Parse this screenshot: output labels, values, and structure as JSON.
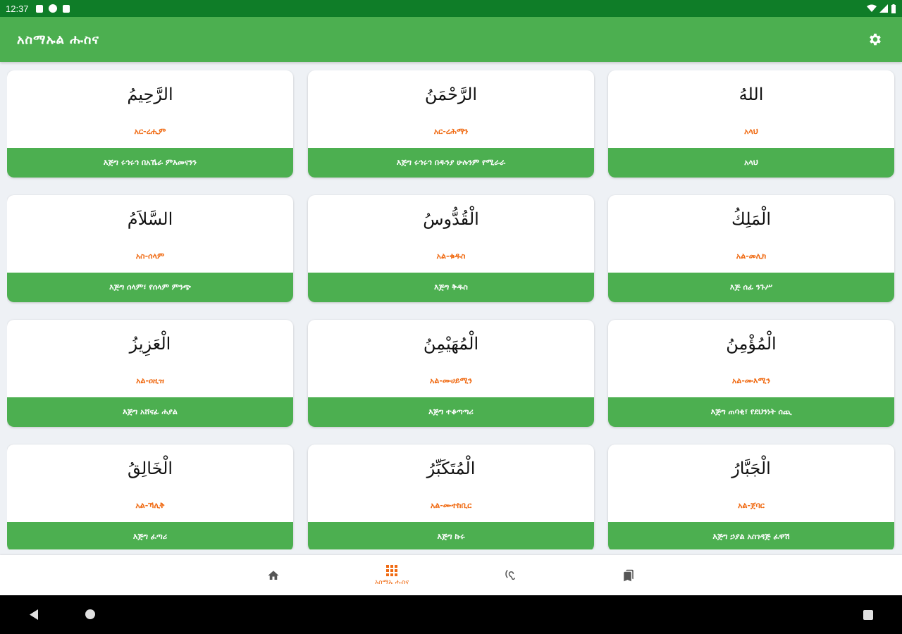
{
  "status_bar": {
    "time": "12:37"
  },
  "app_bar": {
    "title": "አስማኡል ሑስና",
    "settings_icon": "gear-icon"
  },
  "cards": [
    {
      "arabic": "اللهُ",
      "translit": "አላህ",
      "meaning": "አላህ"
    },
    {
      "arabic": "الرَّحْمَنُ",
      "translit": "አር-ረሕማን",
      "meaning": "እጅግ ሩኅሩኅ በዱንያ ሁሉንም የሚራራ"
    },
    {
      "arabic": "الرَّحِيمُ",
      "translit": "አር-ረሒም",
      "meaning": "እጅግ ሩኅሩኅ በአኼራ ምእመናንን"
    },
    {
      "arabic": "الْمَلِكُ",
      "translit": "አል-መሊክ",
      "meaning": "እጅ ሰፊ ንጉሥ"
    },
    {
      "arabic": "الْقُدُّوسُ",
      "translit": "አል-ቁዱስ",
      "meaning": "እጅግ ቅዱስ"
    },
    {
      "arabic": "السَّلاَمُ",
      "translit": "አስ-ሰላም",
      "meaning": "እጅግ ሰላም፣ የሰላም ምንጭ"
    },
    {
      "arabic": "الْمُؤْمِنُ",
      "translit": "አል-ሙእሚን",
      "meaning": "እጅግ ጠባቂ፣ የደህንነት ሰጪ"
    },
    {
      "arabic": "الْمُهَيْمِنُ",
      "translit": "አል-ሙሀይሚን",
      "meaning": "እጅግ ተቆጣጣሪ"
    },
    {
      "arabic": "الْعَزِيزُ",
      "translit": "አል-ዐዚዝ",
      "meaning": "እጅግ አሸናፊ ሐያል"
    },
    {
      "arabic": "الْجَبَّارُ",
      "translit": "አል-ጀባር",
      "meaning": "እጅግ ኃያል አስገዳጅ ፈዋሽ"
    },
    {
      "arabic": "الْمُتَكَبِّرُ",
      "translit": "አል-ሙተከቢር",
      "meaning": "እጅግ ኩሩ"
    },
    {
      "arabic": "الْخَالِقُ",
      "translit": "አል-ኻሊቅ",
      "meaning": "እጅግ ፈጣሪ"
    }
  ],
  "bottom_nav": {
    "home_icon": "home-icon",
    "grid_icon": "grid-icon",
    "grid_label": "አስማኡ ሑስና",
    "audio_icon": "ear-icon",
    "bookmark_icon": "bookmark-icon",
    "active_color": "#f06a12"
  },
  "colors": {
    "status_bar": "#0f7d28",
    "app_bar": "#4caf50",
    "accent": "#f06a12"
  }
}
